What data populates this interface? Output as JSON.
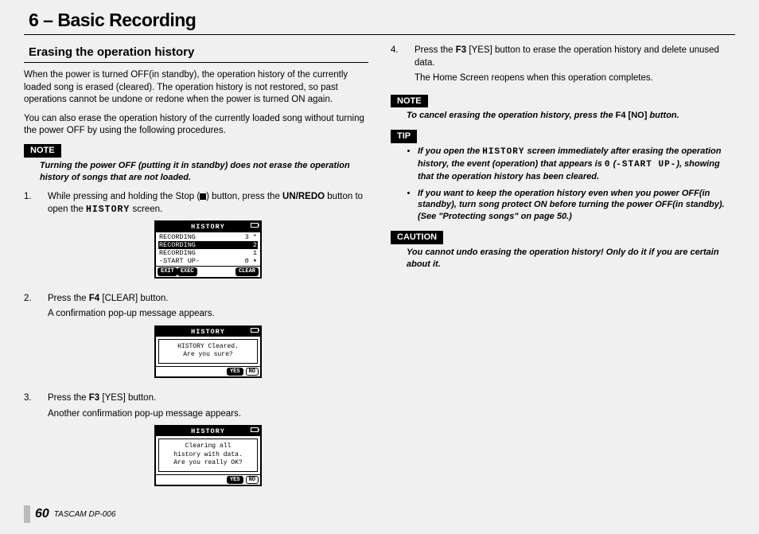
{
  "chapter": "6 – Basic Recording",
  "section": "Erasing the operation history",
  "col1": {
    "p1": "When the power is turned OFF(in standby), the operation history of the currently loaded song is erased (cleared). The operation history is not restored, so past operations cannot be undone or redone when the power is turned ON again.",
    "p2": "You can also erase the operation history of the currently loaded song without turning the power OFF by using the following procedures.",
    "noteLabel": "NOTE",
    "note1": "Turning the power OFF (putting it in standby) does not erase the operation history of songs that are not loaded.",
    "step1a": "While pressing and holding the Stop (",
    "step1b": ") button, press the ",
    "step1c": "UN/REDO",
    "step1d": " button to open the ",
    "step1e": "HISTORY",
    "step1f": " screen.",
    "step2a": "Press the ",
    "step2b": "F4",
    "step2c": " [CLEAR] button.",
    "step2d": "A confirmation pop-up message appears.",
    "step3a": "Press the ",
    "step3b": "F3",
    "step3c": " [YES] button.",
    "step3d": "Another confirmation pop-up message appears."
  },
  "col2": {
    "step4a": "Press the ",
    "step4b": "F3",
    "step4c": " [YES] button to erase the operation history and delete unused data.",
    "step4d": "The Home Screen reopens when this operation completes.",
    "noteLabel": "NOTE",
    "note2a": "To cancel erasing the operation history, press the ",
    "note2b": "F4 [NO]",
    "note2c": " button.",
    "tipLabel": "TIP",
    "tip1a": "If you open the ",
    "tip1b": "HISTORY",
    "tip1c": " screen immediately after erasing the operation history, the event (operation) that appears is ",
    "tip1d": "0",
    "tip1e": " (",
    "tip1f": "-START UP-",
    "tip1g": "), showing that the operation history has been cleared.",
    "tip2": "If you want to keep the operation history even when you power OFF(in standby), turn song protect ON before turning the power OFF(in standby). (See \"Protecting songs\" on page 50.)",
    "cautionLabel": "CAUTION",
    "caution": "You cannot undo erasing the operation history! Only do it if you are certain about it."
  },
  "lcd": {
    "title": "HISTORY",
    "rows": [
      {
        "l": "RECORDING",
        "r": "3 *"
      },
      {
        "l": "RECORDING",
        "r": "2  "
      },
      {
        "l": "RECORDING",
        "r": "1  "
      },
      {
        "l": "-START UP-",
        "r": "0 ▾"
      }
    ],
    "exit": "EXIT",
    "exec": "EXEC",
    "clear": "CLEAR",
    "popup1a": "HISTORY Cleared.",
    "popup1b": "Are you sure?",
    "popup2a": "Clearing all",
    "popup2b": "history with data.",
    "popup2c": "Are you really OK?",
    "yes": "YES",
    "no": "NO"
  },
  "footer": {
    "page": "60",
    "product": "TASCAM  DP-006"
  }
}
